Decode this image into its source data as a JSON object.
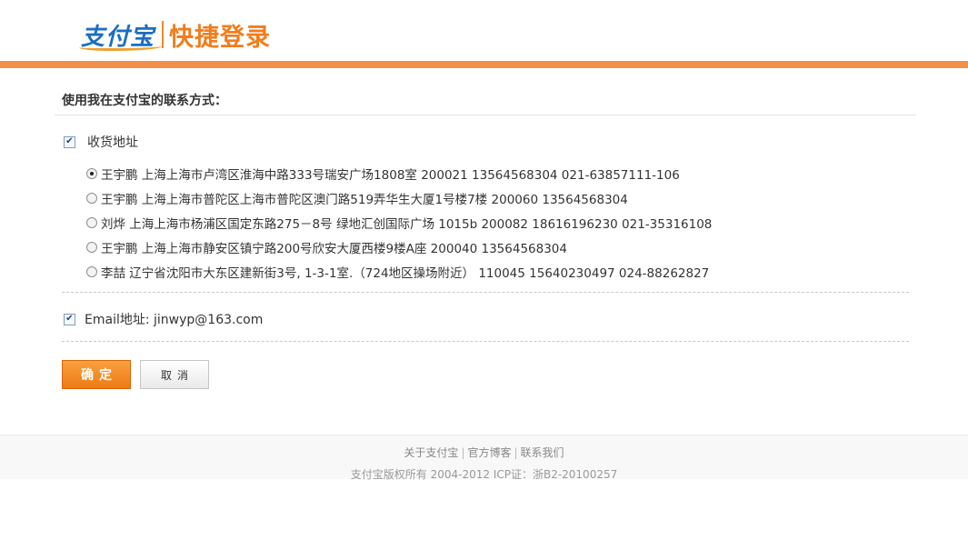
{
  "header": {
    "logo_brand": "支付宝",
    "logo_sub": "快捷登录"
  },
  "contact": {
    "title": "使用我在支付宝的联系方式：",
    "shipping_label": "收货地址",
    "shipping_checked": true,
    "addresses": [
      {
        "text": "王宇鹏 上海上海市卢湾区淮海中路333号瑞安广场1808室 200021 13564568304 021-63857111-106",
        "selected": true
      },
      {
        "text": "王宇鹏 上海上海市普陀区上海市普陀区澳门路519弄华生大厦1号楼7楼 200060 13564568304",
        "selected": false
      },
      {
        "text": "刘烨 上海上海市杨浦区国定东路275－8号 绿地汇创国际广场 1015b 200082 18616196230 021-35316108",
        "selected": false
      },
      {
        "text": "王宇鹏 上海上海市静安区镇宁路200号欣安大厦西楼9楼A座 200040 13564568304",
        "selected": false
      },
      {
        "text": "李喆 辽宁省沈阳市大东区建新街3号, 1-3-1室.（724地区操场附近） 110045 15640230497 024-88262827",
        "selected": false
      }
    ],
    "email_label": "Email地址: jinwyp@163.com",
    "email_checked": true
  },
  "buttons": {
    "confirm": "确定",
    "cancel": "取消"
  },
  "footer": {
    "links": [
      "关于支付宝",
      "官方博客",
      "联系我们"
    ],
    "copyright": "支付宝版权所有 2004-2012 ICP证：浙B2-20100257"
  },
  "colors": {
    "accent": "#f19149",
    "confirm_button": "#ee7a14",
    "brand_blue": "#1b6ec2"
  }
}
